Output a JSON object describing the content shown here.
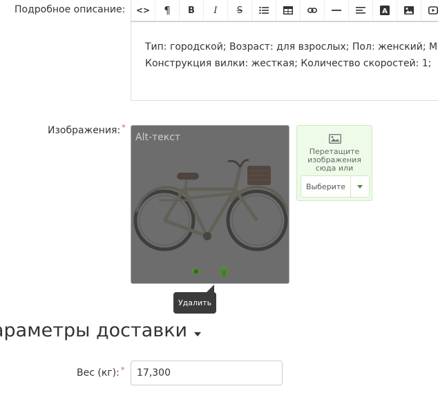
{
  "description_field": {
    "label": "Подробное описание:",
    "toolbar": [
      {
        "name": "code-view-button",
        "icon": "code-icon",
        "glyph": "<>"
      },
      {
        "name": "paragraph-button",
        "icon": "pilcrow-icon",
        "glyph": "¶"
      },
      {
        "name": "bold-button",
        "icon": "bold-icon",
        "glyph": "B"
      },
      {
        "name": "italic-button",
        "icon": "italic-icon",
        "glyph": "I"
      },
      {
        "name": "strikethrough-button",
        "icon": "strikethrough-icon",
        "glyph": "S"
      },
      {
        "name": "list-button",
        "icon": "bulleted-list-icon",
        "glyph": ""
      },
      {
        "name": "table-button",
        "icon": "table-icon",
        "glyph": ""
      },
      {
        "name": "link-button",
        "icon": "link-icon",
        "glyph": ""
      },
      {
        "name": "horizontal-rule-button",
        "icon": "horizontal-rule-icon",
        "glyph": ""
      },
      {
        "name": "align-button",
        "icon": "align-left-icon",
        "glyph": ""
      },
      {
        "name": "text-color-button",
        "icon": "text-color-icon",
        "glyph": "A"
      },
      {
        "name": "insert-image-button",
        "icon": "image-icon",
        "glyph": ""
      },
      {
        "name": "insert-video-button",
        "icon": "video-icon",
        "glyph": ""
      }
    ],
    "lines": [
      "Тип: городской; Возраст: для взрослых; Пол: женский; М",
      "Конструкция вилки: жесткая; Количество скоростей: 1;"
    ]
  },
  "images_field": {
    "label": "Изображения:",
    "required_mark": "*",
    "card": {
      "alt_text": "Alt-текст",
      "image": "bicycle-photo",
      "actions": [
        {
          "name": "preview-button",
          "icon": "eye-icon"
        },
        {
          "name": "delete-button",
          "icon": "trash-icon"
        }
      ]
    },
    "tooltip": "Удалить",
    "dropzone": {
      "icon": "image-icon",
      "text": "Перетащите изображения сюда или",
      "button_label": "Выберите",
      "dropdown_icon": "caret-down-icon"
    }
  },
  "delivery_section": {
    "title": "араметры доставки",
    "toggle_icon": "caret-down-icon"
  },
  "weight_field": {
    "label": "Вес (кг):",
    "required_mark": "*",
    "value": "17,300"
  },
  "colors": {
    "accent_green": "#4a8f2e",
    "dropzone_bg": "#eefbe8",
    "required_red": "#d9534f",
    "tooltip_bg": "#3b3b3b"
  }
}
